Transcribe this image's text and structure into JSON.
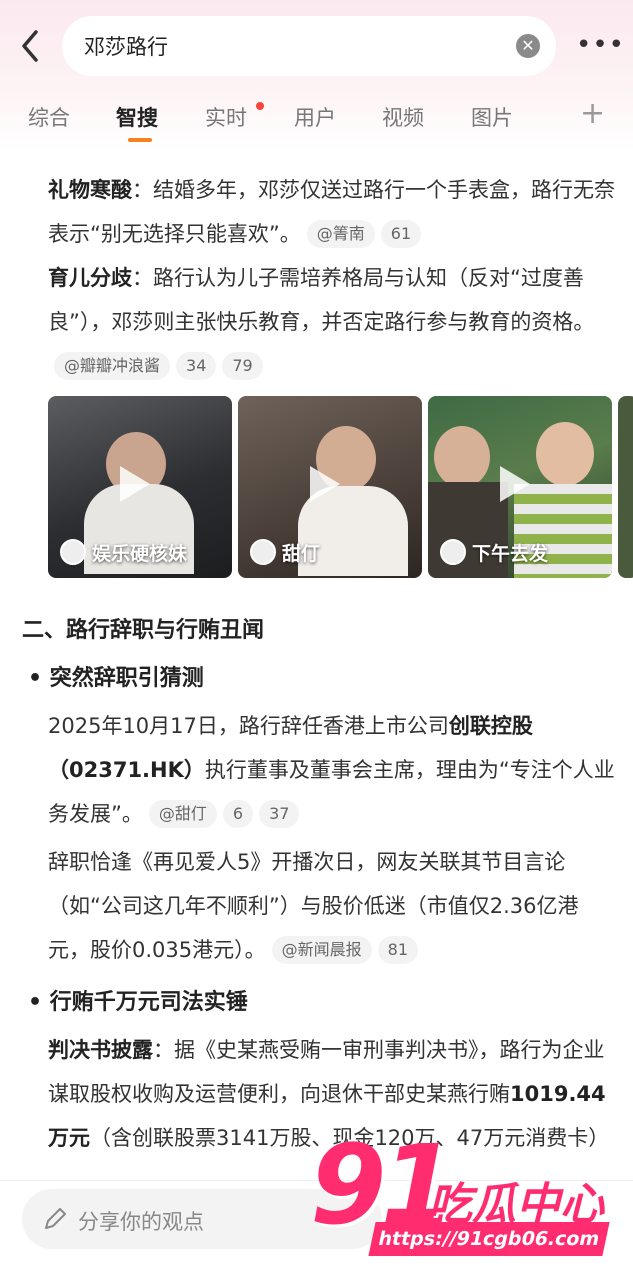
{
  "search": {
    "query": "邓莎路行",
    "clear_icon": "close-circle-icon"
  },
  "tabs": [
    {
      "label": "综合"
    },
    {
      "label": "智搜"
    },
    {
      "label": "实时"
    },
    {
      "label": "用户"
    },
    {
      "label": "视频"
    },
    {
      "label": "图片"
    }
  ],
  "plus_label": "+",
  "more_label": "•••",
  "items": [
    {
      "title": "礼物寒酸",
      "text": "：结婚多年，邓莎仅送过路行一个手表盒，路行无奈表示“别无选择只能喜欢”。",
      "cite": "@箐南",
      "count": "61"
    },
    {
      "title": "育儿分歧",
      "text": "：路行认为儿子需培养格局与认知（反对“过度善良”），邓莎则主张快乐教育，并否定路行参与教育的资格。",
      "cite": "@瓣瓣冲浪酱",
      "count1": "34",
      "count2": "79"
    }
  ],
  "videos": [
    {
      "label": "娱乐硬核妹"
    },
    {
      "label": "甜仃"
    },
    {
      "label": "下午去发"
    }
  ],
  "section2": {
    "heading": "二、路行辞职与行贿丑闻"
  },
  "bullet1": {
    "title": "• 突然辞职引猜测"
  },
  "p1": {
    "text_a": "2025年10月17日，路行辞任香港上市公司",
    "bold": "创联控股（02371.HK）",
    "text_b": "执行董事及董事会主席，理由为“专注个人业务发展”。",
    "cite": "@甜仃",
    "count1": "6",
    "count2": "37"
  },
  "p2": {
    "text": "辞职恰逢《再见爱人5》开播次日，网友关联其节目言论（如“公司这几年不顺利”）与股价低迷（市值仅2.36亿港元，股价0.035港元）。",
    "cite": "@新闻晨报",
    "count": "81"
  },
  "bullet2": {
    "title": "• 行贿千万元司法实锤"
  },
  "p3": {
    "title": "判决书披露",
    "text_a": "：据《史某燕受贿一审刑事判决书》，路行为企业谋取股权收购及运营便利，向退休干部史某燕行贿",
    "bold": "1019.44万元",
    "text_b": "（含创联股票3141万股、现金120万、47万元消费卡）"
  },
  "bottom": {
    "share_placeholder": "分享你的观点"
  },
  "watermark": {
    "num": "91",
    "cn": "吃瓜中心",
    "url": "https://91cgb06.com"
  }
}
